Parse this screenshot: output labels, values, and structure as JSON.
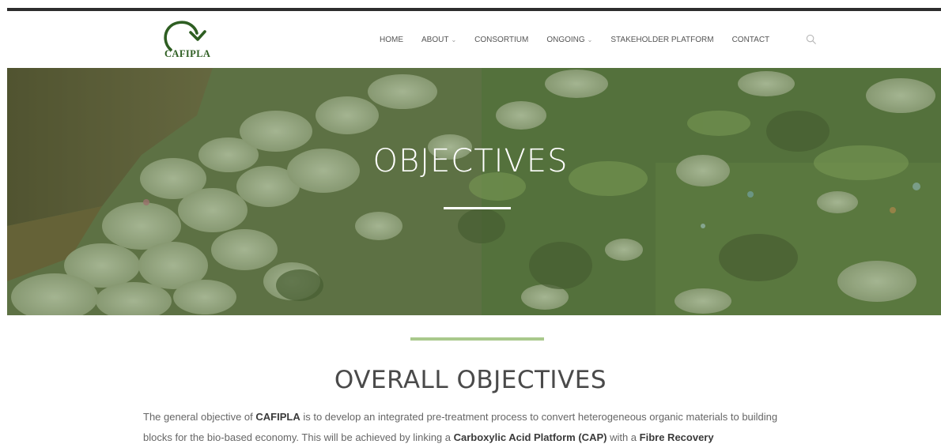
{
  "brand": {
    "name": "CAFIPLA",
    "logo_color": "#2e5e22"
  },
  "nav": {
    "items": [
      {
        "label": "HOME",
        "dropdown": false
      },
      {
        "label": "ABOUT",
        "dropdown": true
      },
      {
        "label": "CONSORTIUM",
        "dropdown": false
      },
      {
        "label": "ONGOING",
        "dropdown": true
      },
      {
        "label": "STAKEHOLDER PLATFORM",
        "dropdown": false
      },
      {
        "label": "CONTACT",
        "dropdown": false
      }
    ],
    "search_icon": "search-icon"
  },
  "hero": {
    "title": "OBJECTIVES"
  },
  "section": {
    "title": "OVERALL OBJECTIVES",
    "paragraph": {
      "t1": "The general objective of ",
      "b1": "CAFIPLA",
      "t2": " is to develop an integrated pre-treatment process to convert heterogeneous organic materials to building blocks for the bio-based economy. This will be achieved by linking a ",
      "b2": "Carboxylic Acid Platform (CAP)",
      "t3": " with a ",
      "b3": "Fibre Recovery"
    }
  },
  "colors": {
    "accent_green": "#a9c98c",
    "top_bar": "#2d2d2d",
    "text_gray": "#666666"
  }
}
